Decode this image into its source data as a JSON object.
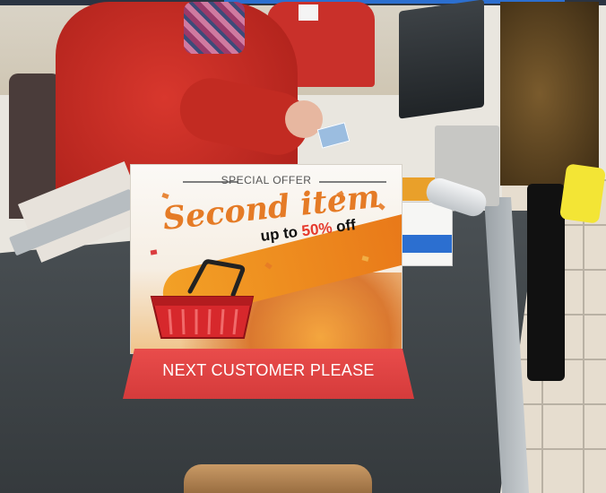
{
  "sign": {
    "header": "SPECIAL OFFER",
    "headline": "Second item",
    "subline_prefix": "up to ",
    "subline_percent": "50%",
    "subline_suffix": " off",
    "footer": "NEXT CUSTOMER PLEASE"
  },
  "colors": {
    "headline_orange": "#e57b26",
    "percent_red": "#e53a2d",
    "base_red": "#d53b3b",
    "basket_red": "#d7282c"
  }
}
